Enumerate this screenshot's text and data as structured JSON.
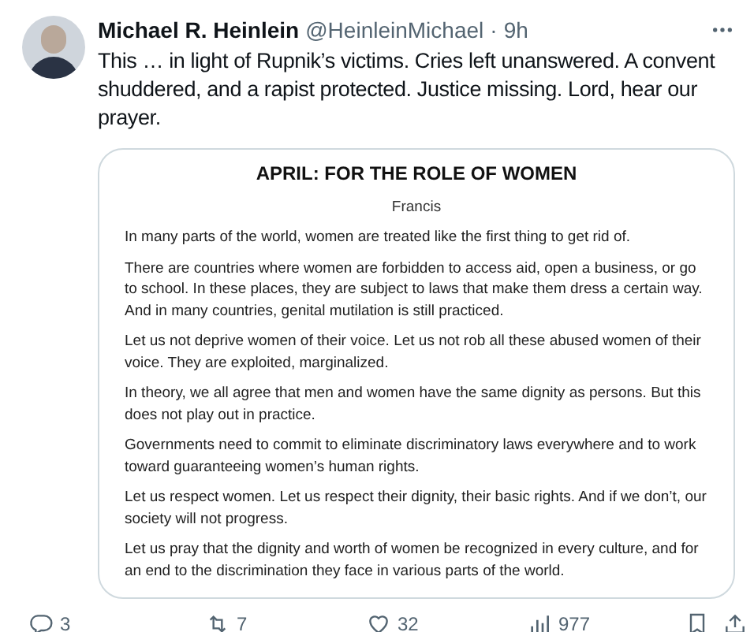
{
  "post": {
    "author": "Michael R. Heinlein",
    "handle": "@HeinleinMichael",
    "separator": "·",
    "time": "9h",
    "text": "This … in light of Rupnik’s victims. Cries left unanswered. A convent shuddered, and a rapist protected. Justice missing. Lord, hear our prayer."
  },
  "attachment": {
    "title": "APRIL: FOR THE ROLE OF WOMEN",
    "author": "Francis",
    "paragraphs": [
      "In many parts of the world, women are treated like the first thing to get rid of.",
      "There are countries where women are forbidden to access aid, open a business, or go to school. In these places, they are subject to laws that make them dress a certain way. And in many countries, genital mutilation is still practiced.",
      "Let us not deprive women of their voice. Let us not rob all these abused women of their voice. They are exploited, marginalized.",
      "In theory, we all agree that men and women have the same dignity as persons. But this does not play out in practice.",
      "Governments need to commit to eliminate discriminatory laws everywhere and to work toward guaranteeing women’s human rights.",
      "Let us respect women. Let us respect their dignity, their basic rights. And if we don’t, our society will not progress.",
      "Let us pray that the dignity and worth of women be recognized in every culture, and for an end to the discrimination they face in various parts of the world."
    ]
  },
  "actions": [
    {
      "kind": "reply",
      "count": "3"
    },
    {
      "kind": "repost",
      "count": "7"
    },
    {
      "kind": "like",
      "count": "32"
    },
    {
      "kind": "views",
      "count": "977"
    },
    {
      "kind": "bookmark"
    },
    {
      "kind": "share"
    }
  ]
}
